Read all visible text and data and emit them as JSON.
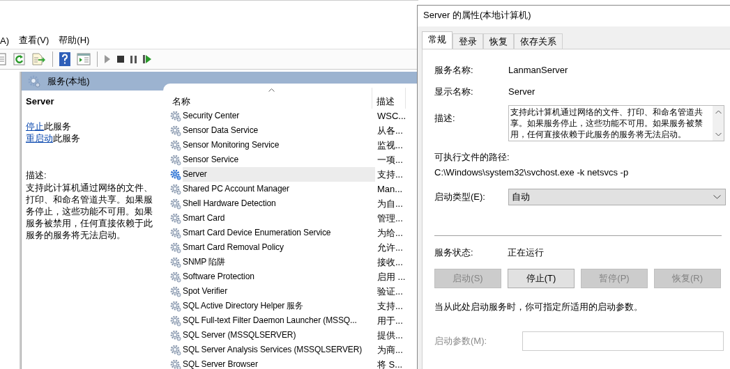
{
  "menu": [
    {
      "label": "A)"
    },
    {
      "label": "查看(V)"
    },
    {
      "label": "帮助(H)"
    }
  ],
  "panel_title": "服务(本地)",
  "detail": {
    "name": "Server",
    "actions": [
      {
        "link": "停止",
        "text": "此服务"
      },
      {
        "link": "重启动",
        "text": "此服务"
      }
    ],
    "description_label": "描述:",
    "description": "支持此计算机通过网络的文件、打印、和命名管道共享。如果服务停止，这些功能不可用。如果服务被禁用，任何直接依赖于此服务的服务将无法启动。"
  },
  "table": {
    "columns": [
      {
        "label": "名称",
        "sorted": true
      },
      {
        "label": "描述",
        "sorted": false
      }
    ],
    "rows": [
      {
        "name": "Security Center",
        "description": "WSC...",
        "selected": false
      },
      {
        "name": "Sensor Data Service",
        "description": "从各...",
        "selected": false
      },
      {
        "name": "Sensor Monitoring Service",
        "description": "监视...",
        "selected": false
      },
      {
        "name": "Sensor Service",
        "description": "一项...",
        "selected": false
      },
      {
        "name": "Server",
        "description": "支持...",
        "selected": true
      },
      {
        "name": "Shared PC Account Manager",
        "description": "Man...",
        "selected": false
      },
      {
        "name": "Shell Hardware Detection",
        "description": "为自...",
        "selected": false
      },
      {
        "name": "Smart Card",
        "description": "管理...",
        "selected": false
      },
      {
        "name": "Smart Card Device Enumeration Service",
        "description": "为给...",
        "selected": false
      },
      {
        "name": "Smart Card Removal Policy",
        "description": "允许...",
        "selected": false
      },
      {
        "name": "SNMP 陷阱",
        "description": "接收...",
        "selected": false
      },
      {
        "name": "Software Protection",
        "description": "启用 ...",
        "selected": false
      },
      {
        "name": "Spot Verifier",
        "description": "验证...",
        "selected": false
      },
      {
        "name": "SQL Active Directory Helper 服务",
        "description": "支持...",
        "selected": false
      },
      {
        "name": "SQL Full-text Filter Daemon Launcher (MSSQ...",
        "description": "用于...",
        "selected": false
      },
      {
        "name": "SQL Server (MSSQLSERVER)",
        "description": "提供...",
        "selected": false
      },
      {
        "name": "SQL Server Analysis Services (MSSQLSERVER)",
        "description": "为商...",
        "selected": false
      },
      {
        "name": "SQL Server Browser",
        "description": "将 S...",
        "selected": false
      }
    ]
  },
  "dialog": {
    "title": "Server 的属性(本地计算机)",
    "tabs": [
      {
        "label": "常规",
        "selected": true
      },
      {
        "label": "登录",
        "selected": false
      },
      {
        "label": "恢复",
        "selected": false
      },
      {
        "label": "依存关系",
        "selected": false
      }
    ],
    "fields": [
      {
        "label": "服务名称:",
        "value": "LanmanServer"
      },
      {
        "label": "显示名称:",
        "value": "Server"
      }
    ],
    "description_label": "描述:",
    "description": "支持此计算机通过网络的文件、打印、和命名管道共享。如果服务停止，这些功能不可用。如果服务被禁用，任何直接依赖于此服务的服务将无法启动。",
    "path_label": "可执行文件的路径:",
    "path": "C:\\Windows\\system32\\svchost.exe -k netsvcs -p",
    "startup_type_label": "启动类型(E):",
    "startup_type": "自动",
    "status_label": "服务状态:",
    "status": "正在运行",
    "buttons": [
      {
        "label": "启动(S)",
        "disabled": true
      },
      {
        "label": "停止(T)",
        "disabled": false
      },
      {
        "label": "暂停(P)",
        "disabled": true
      },
      {
        "label": "恢复(R)",
        "disabled": true
      }
    ],
    "hint": "当从此处启动服务时，你可指定所适用的启动参数。",
    "params": {
      "label": "启动参数(M):",
      "disabled": true
    }
  }
}
